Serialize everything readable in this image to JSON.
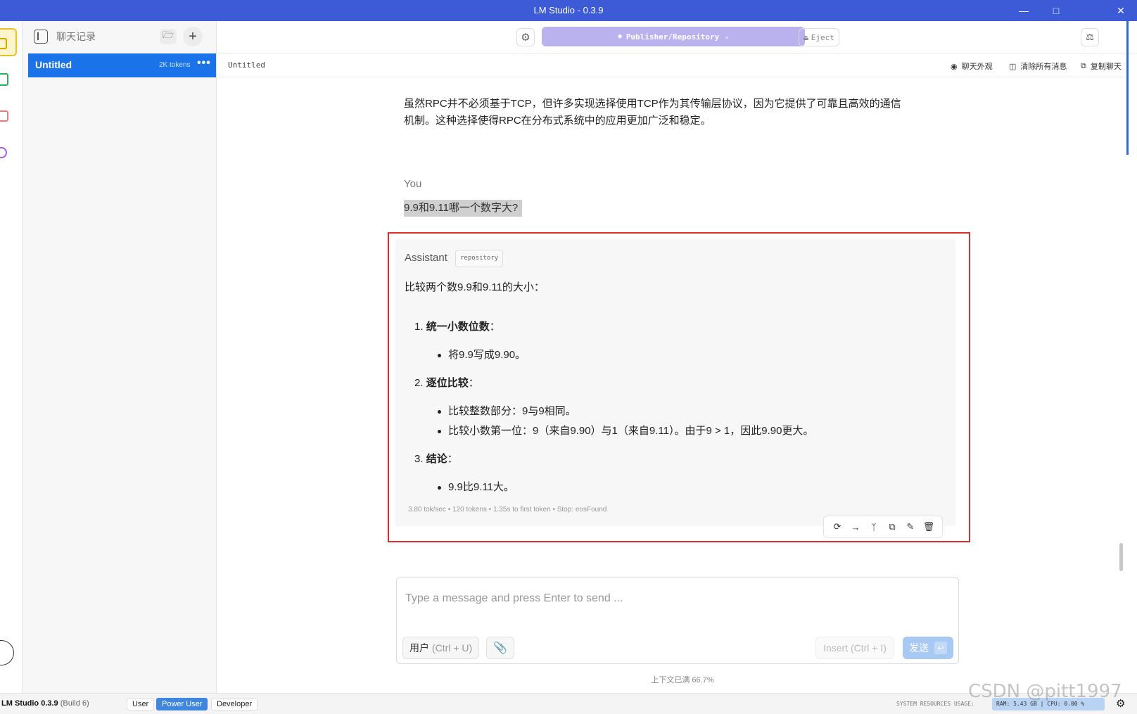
{
  "window": {
    "title": "LM Studio - 0.3.9",
    "minimize_icon": "minimize-icon",
    "maximize_icon": "maximize-icon",
    "close_icon": "close-icon"
  },
  "sidebar": {
    "title": "聊天记录",
    "chats": [
      {
        "name": "Untitled",
        "tokens": "2K tokens",
        "more": "•••"
      }
    ]
  },
  "toolbar": {
    "model_label": "Publisher/Repository",
    "eject_label": "Eject"
  },
  "chat_header": {
    "name": "Untitled",
    "actions": [
      {
        "label": "聊天外观",
        "icon": "palette-icon"
      },
      {
        "label": "清除所有消息",
        "icon": "clear-icon"
      },
      {
        "label": "复制聊天",
        "icon": "copy-icon"
      }
    ]
  },
  "messages": {
    "previous_paragraph_line1": "虽然RPC并不必须基于TCP，但许多实现选择使用TCP作为其传输层协议，因为它提供了可靠且高效的通信",
    "previous_paragraph_line2": "机制。这种选择使得RPC在分布式系统中的应用更加广泛和稳定。",
    "user_label": "You",
    "user_message": "9.9和9.11哪一个数字大?",
    "assistant_label": "Assistant",
    "assistant_tag": "repository",
    "assistant_intro": "比较两个数9.9和9.11的大小：",
    "steps": [
      {
        "number": "1.",
        "title": "统一小数位数",
        "colon": "：",
        "bullets": [
          "将9.9写成9.90。"
        ]
      },
      {
        "number": "2.",
        "title": "逐位比较",
        "colon": "：",
        "bullets": [
          "比较整数部分：9与9相同。",
          "比较小数第一位：9（来自9.90）与1（来自9.11）。由于9 > 1，因此9.90更大。"
        ]
      },
      {
        "number": "3.",
        "title": "结论",
        "colon": "：",
        "bullets": [
          "9.9比9.11大。"
        ]
      }
    ],
    "stats": "3.80 tok/sec • 120 tokens • 1.35s to first token • Stop: eosFound"
  },
  "message_tools": [
    "regenerate-icon",
    "continue-icon",
    "branch-icon",
    "copy-icon",
    "edit-icon",
    "delete-icon"
  ],
  "composer": {
    "placeholder": "Type a message and press Enter to send ...",
    "role_label": "用户",
    "role_shortcut": "(Ctrl + U)",
    "insert_label": "Insert",
    "insert_shortcut": "(Ctrl + I)",
    "send_label": "发送",
    "context_usage": "上下文已满 66.7%"
  },
  "statusbar": {
    "app_name": "LM Studio 0.3.9",
    "build": "(Build 6)",
    "modes": [
      "User",
      "Power User",
      "Developer"
    ],
    "active_mode": "Power User",
    "system_resources_label": "SYSTEM RESOURCES USAGE:",
    "resources_value": "RAM: 5.43 GB | CPU: 0.00 %"
  },
  "watermark": "CSDN @pitt1997",
  "colors": {
    "titlebar": "#3d5bd6",
    "accent": "#1a73e8",
    "model_button": "#b9b2ef",
    "highlight_border": "#e12a2a"
  }
}
